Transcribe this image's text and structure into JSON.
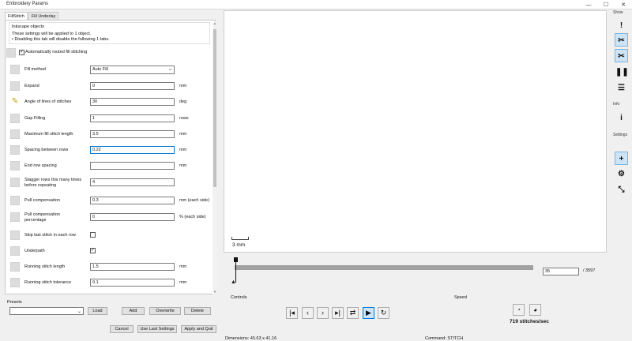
{
  "window": {
    "title": "Embroidery Params",
    "minimize": "—",
    "maximize": "☐",
    "close": "✕"
  },
  "tabs": [
    "FillStitch",
    "Fill Underlay"
  ],
  "info": {
    "heading": "Inkscape objects",
    "line1": "These settings will be applied to 1 object.",
    "line2": "• Disabling this tab will disable the following 1 tabs."
  },
  "auto_route": {
    "label": "Automatically routed fill stitching",
    "checked": "✓"
  },
  "params": [
    {
      "label": "Fill method",
      "type": "select",
      "value": "Auto Fill",
      "unit": ""
    },
    {
      "label": "Expand",
      "type": "input",
      "value": "0",
      "unit": "mm"
    },
    {
      "label": "Angle of lines of stitches",
      "type": "input",
      "value": "30",
      "unit": "deg"
    },
    {
      "label": "Gap Filling",
      "type": "input",
      "value": "1",
      "unit": "rows"
    },
    {
      "label": "Maximum fill stitch length",
      "type": "input",
      "value": "3.5",
      "unit": "mm"
    },
    {
      "label": "Spacing between rows",
      "type": "input",
      "value": "0.22",
      "unit": "mm"
    },
    {
      "label": "End row spacing",
      "type": "input",
      "value": "",
      "unit": "mm"
    },
    {
      "label": "Stagger rows this many times before repeating",
      "type": "input",
      "value": "4",
      "unit": ""
    },
    {
      "label": "Pull compensation",
      "type": "input",
      "value": "0.3",
      "unit": "mm (each side)"
    },
    {
      "label": "Pull compensation percentage",
      "type": "input",
      "value": "0",
      "unit": "% (each side)"
    },
    {
      "label": "Skip last stitch in each row",
      "type": "checkbox",
      "value": "",
      "unit": ""
    },
    {
      "label": "Underpath",
      "type": "checkbox",
      "value": "✓",
      "unit": ""
    },
    {
      "label": "Running stitch length",
      "type": "input",
      "value": "1.5",
      "unit": "mm"
    },
    {
      "label": "Running stitch tolerance",
      "type": "input",
      "value": "0.1",
      "unit": "mm"
    }
  ],
  "presets": {
    "label": "Presets",
    "value": "",
    "load": "Load",
    "add": "Add",
    "overwrite": "Overwrite",
    "delete": "Delete"
  },
  "footer": {
    "cancel": "Cancel",
    "use_last": "Use Last Settings",
    "apply": "Apply and Quit"
  },
  "preview": {
    "scale_label": "3 mm"
  },
  "sidebar": {
    "show_label": "Show",
    "info_label": "Info",
    "settings_label": "Settings",
    "icons": [
      "jump-icon",
      "trim-icon",
      "scissors-icon",
      "pause-icon",
      "stop-icon",
      "info-icon",
      "plus-icon",
      "gear-icon",
      "resize-icon"
    ]
  },
  "simulator": {
    "current_stitch": "35",
    "total_stitches": "/ 3597",
    "controls_label": "Controls",
    "speed_label": "Speed",
    "speed_value": "719 stitches/sec",
    "progress_fraction": 0.0097
  },
  "status": {
    "dimensions": "Dimensions: 45.63 x 41.16",
    "command": "Command: STITCH"
  }
}
